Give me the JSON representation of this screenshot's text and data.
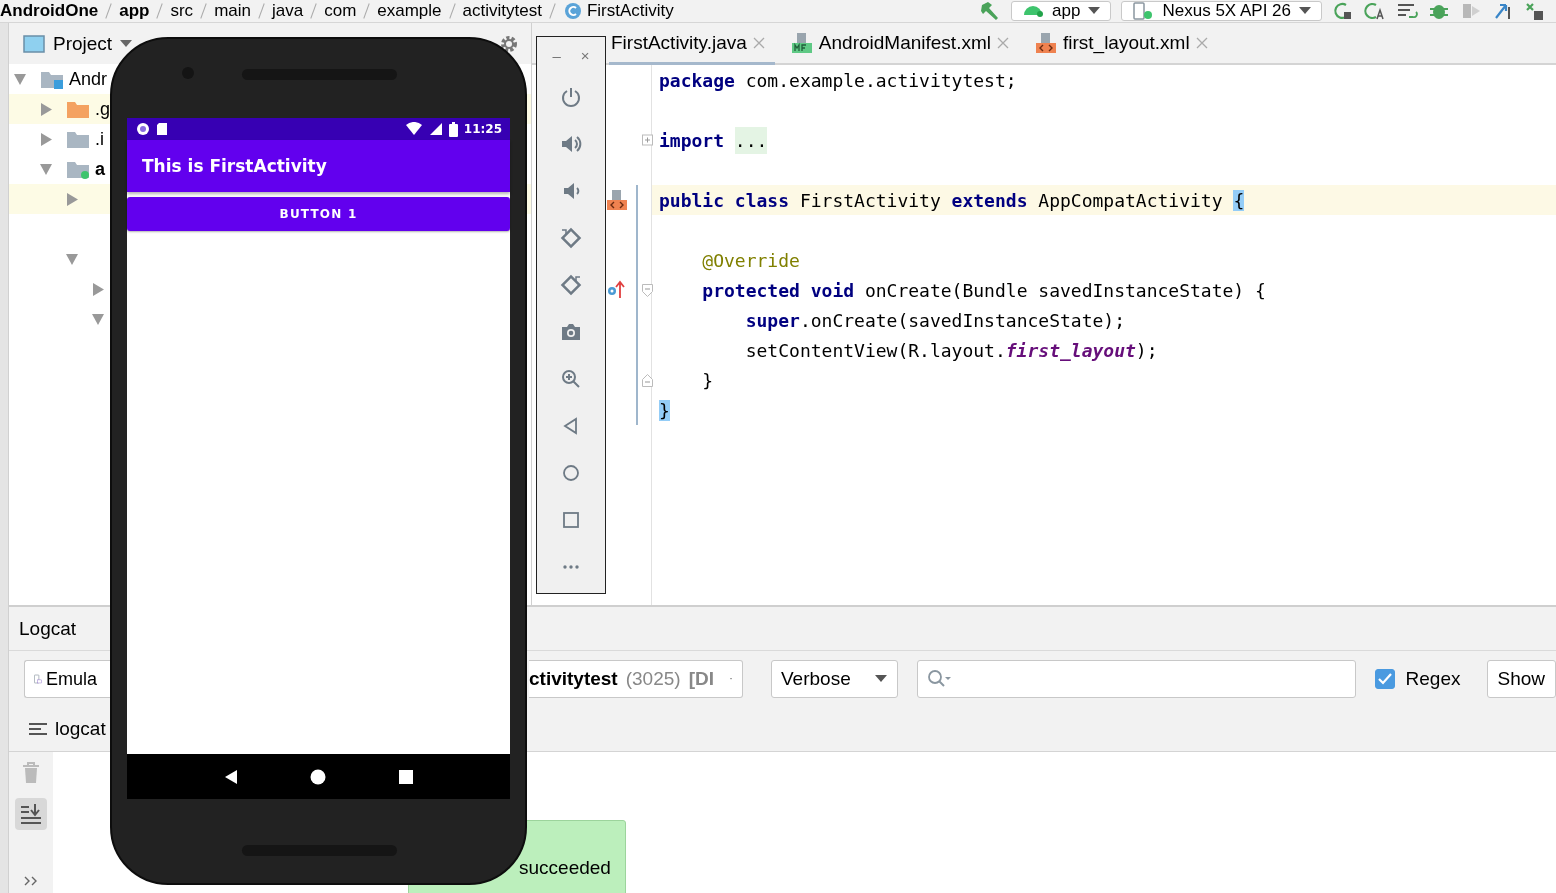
{
  "breadcrumb": [
    {
      "label": "AndroidOne",
      "kind": "module"
    },
    {
      "label": "app",
      "kind": "module"
    },
    {
      "label": "src",
      "kind": "folder"
    },
    {
      "label": "main",
      "kind": "folder"
    },
    {
      "label": "java",
      "kind": "folder"
    },
    {
      "label": "com",
      "kind": "folder"
    },
    {
      "label": "example",
      "kind": "folder"
    },
    {
      "label": "activitytest",
      "kind": "folder"
    },
    {
      "label": "FirstActivity",
      "kind": "class"
    }
  ],
  "toolbar": {
    "run_config": "app",
    "device": "Nexus 5X API 26"
  },
  "project_panel": {
    "title": "Project",
    "tree": [
      {
        "label": "Andr",
        "kind": "project",
        "expandable": true,
        "expanded": true,
        "highlighted": false,
        "children": [
          {
            "label": ".g",
            "kind": "excluded",
            "expandable": true,
            "expanded": false,
            "highlighted": true
          },
          {
            "label": ".i",
            "kind": "folder",
            "expandable": true,
            "expanded": false,
            "highlighted": false
          },
          {
            "label": "a",
            "kind": "module",
            "expandable": true,
            "expanded": true,
            "highlighted": false,
            "children": [
              {
                "expandable": true,
                "expanded": false,
                "highlighted": true
              },
              {
                "expandable": false,
                "highlighted": false
              },
              {
                "expandable": true,
                "expanded": true,
                "highlighted": false,
                "children": [
                  {
                    "expandable": true,
                    "expanded": false,
                    "highlighted": false
                  },
                  {
                    "expandable": true,
                    "expanded": true,
                    "highlighted": false
                  }
                ]
              }
            ]
          }
        ]
      }
    ]
  },
  "editor": {
    "tabs": [
      {
        "label": "FirstActivity.java",
        "selected": true
      },
      {
        "label": "AndroidManifest.xml",
        "kind": "manifest",
        "selected": false
      },
      {
        "label": "first_layout.xml",
        "kind": "layout",
        "selected": false
      }
    ],
    "lines": [
      {
        "kind": "code",
        "current": false,
        "changed": false,
        "tokens": [
          {
            "text": "package",
            "kind": "keyword"
          },
          {
            "text": " com.example.activitytest;",
            "kind": "plain"
          }
        ]
      },
      {
        "kind": "blank",
        "current": false,
        "changed": false
      },
      {
        "kind": "code",
        "current": false,
        "changed": false,
        "fold": {
          "kind": "expand"
        },
        "tokens": [
          {
            "text": "import ",
            "kind": "keyword"
          },
          {
            "text": "...",
            "kind": "folded"
          }
        ]
      },
      {
        "kind": "blank",
        "current": false,
        "changed": false
      },
      {
        "kind": "code",
        "current": true,
        "changed": true,
        "gutter_icon": {
          "kind": "layout"
        },
        "tokens": [
          {
            "text": "public class",
            "kind": "keyword"
          },
          {
            "text": " FirstActivity ",
            "kind": "plain"
          },
          {
            "text": "extends",
            "kind": "keyword"
          },
          {
            "text": " AppCompatActivity ",
            "kind": "plain"
          },
          {
            "text": "{",
            "kind": "match"
          }
        ]
      },
      {
        "kind": "blank",
        "current": false,
        "changed": true
      },
      {
        "kind": "code",
        "current": false,
        "changed": true,
        "tokens": [
          {
            "text": "    @Override",
            "kind": "annotation"
          }
        ]
      },
      {
        "kind": "code",
        "current": false,
        "changed": true,
        "gutter_icon": {
          "kind": "override"
        },
        "fold": {
          "kind": "start"
        },
        "tokens": [
          {
            "text": "    protected void",
            "kind": "keyword"
          },
          {
            "text": " onCreate(Bundle savedInstanceState) {",
            "kind": "plain"
          }
        ]
      },
      {
        "kind": "code",
        "current": false,
        "changed": true,
        "tokens": [
          {
            "text": "        super",
            "kind": "keyword"
          },
          {
            "text": ".onCreate(savedInstanceState);",
            "kind": "plain"
          }
        ]
      },
      {
        "kind": "code",
        "current": false,
        "changed": true,
        "tokens": [
          {
            "text": "        setContentView(R.layout.",
            "kind": "plain"
          },
          {
            "text": "first_layout",
            "kind": "field"
          },
          {
            "text": ");",
            "kind": "plain"
          }
        ]
      },
      {
        "kind": "code",
        "current": false,
        "changed": true,
        "fold": {
          "kind": "end"
        },
        "tokens": [
          {
            "text": "    }",
            "kind": "plain"
          }
        ]
      },
      {
        "kind": "code",
        "current": false,
        "changed": true,
        "tokens": [
          {
            "text": "}",
            "kind": "match"
          }
        ]
      }
    ]
  },
  "emulator": {
    "minimize": "–",
    "close": "×",
    "status_time": "11:25",
    "app_title": "This is FirstActivity",
    "button": "BUTTON 1"
  },
  "logcat": {
    "title": "Logcat",
    "device": "Emula",
    "process": [
      {
        "text": "ctivitytest",
        "kind": "name"
      },
      {
        "text": "(3025)",
        "kind": "pid"
      },
      {
        "text": "[DI",
        "kind": "state"
      }
    ],
    "level": "Verbose",
    "regex": {
      "label": "Regex",
      "checked": true
    },
    "show": "Show",
    "tab": "logcat"
  },
  "toast": {
    "text": "succeeded"
  }
}
